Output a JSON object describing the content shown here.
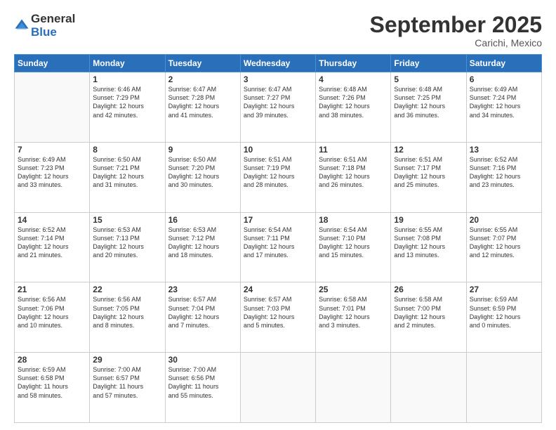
{
  "logo": {
    "general": "General",
    "blue": "Blue"
  },
  "header": {
    "month": "September 2025",
    "location": "Carichi, Mexico"
  },
  "days_of_week": [
    "Sunday",
    "Monday",
    "Tuesday",
    "Wednesday",
    "Thursday",
    "Friday",
    "Saturday"
  ],
  "weeks": [
    [
      {
        "day": "",
        "info": ""
      },
      {
        "day": "1",
        "info": "Sunrise: 6:46 AM\nSunset: 7:29 PM\nDaylight: 12 hours\nand 42 minutes."
      },
      {
        "day": "2",
        "info": "Sunrise: 6:47 AM\nSunset: 7:28 PM\nDaylight: 12 hours\nand 41 minutes."
      },
      {
        "day": "3",
        "info": "Sunrise: 6:47 AM\nSunset: 7:27 PM\nDaylight: 12 hours\nand 39 minutes."
      },
      {
        "day": "4",
        "info": "Sunrise: 6:48 AM\nSunset: 7:26 PM\nDaylight: 12 hours\nand 38 minutes."
      },
      {
        "day": "5",
        "info": "Sunrise: 6:48 AM\nSunset: 7:25 PM\nDaylight: 12 hours\nand 36 minutes."
      },
      {
        "day": "6",
        "info": "Sunrise: 6:49 AM\nSunset: 7:24 PM\nDaylight: 12 hours\nand 34 minutes."
      }
    ],
    [
      {
        "day": "7",
        "info": "Sunrise: 6:49 AM\nSunset: 7:23 PM\nDaylight: 12 hours\nand 33 minutes."
      },
      {
        "day": "8",
        "info": "Sunrise: 6:50 AM\nSunset: 7:21 PM\nDaylight: 12 hours\nand 31 minutes."
      },
      {
        "day": "9",
        "info": "Sunrise: 6:50 AM\nSunset: 7:20 PM\nDaylight: 12 hours\nand 30 minutes."
      },
      {
        "day": "10",
        "info": "Sunrise: 6:51 AM\nSunset: 7:19 PM\nDaylight: 12 hours\nand 28 minutes."
      },
      {
        "day": "11",
        "info": "Sunrise: 6:51 AM\nSunset: 7:18 PM\nDaylight: 12 hours\nand 26 minutes."
      },
      {
        "day": "12",
        "info": "Sunrise: 6:51 AM\nSunset: 7:17 PM\nDaylight: 12 hours\nand 25 minutes."
      },
      {
        "day": "13",
        "info": "Sunrise: 6:52 AM\nSunset: 7:16 PM\nDaylight: 12 hours\nand 23 minutes."
      }
    ],
    [
      {
        "day": "14",
        "info": "Sunrise: 6:52 AM\nSunset: 7:14 PM\nDaylight: 12 hours\nand 21 minutes."
      },
      {
        "day": "15",
        "info": "Sunrise: 6:53 AM\nSunset: 7:13 PM\nDaylight: 12 hours\nand 20 minutes."
      },
      {
        "day": "16",
        "info": "Sunrise: 6:53 AM\nSunset: 7:12 PM\nDaylight: 12 hours\nand 18 minutes."
      },
      {
        "day": "17",
        "info": "Sunrise: 6:54 AM\nSunset: 7:11 PM\nDaylight: 12 hours\nand 17 minutes."
      },
      {
        "day": "18",
        "info": "Sunrise: 6:54 AM\nSunset: 7:10 PM\nDaylight: 12 hours\nand 15 minutes."
      },
      {
        "day": "19",
        "info": "Sunrise: 6:55 AM\nSunset: 7:08 PM\nDaylight: 12 hours\nand 13 minutes."
      },
      {
        "day": "20",
        "info": "Sunrise: 6:55 AM\nSunset: 7:07 PM\nDaylight: 12 hours\nand 12 minutes."
      }
    ],
    [
      {
        "day": "21",
        "info": "Sunrise: 6:56 AM\nSunset: 7:06 PM\nDaylight: 12 hours\nand 10 minutes."
      },
      {
        "day": "22",
        "info": "Sunrise: 6:56 AM\nSunset: 7:05 PM\nDaylight: 12 hours\nand 8 minutes."
      },
      {
        "day": "23",
        "info": "Sunrise: 6:57 AM\nSunset: 7:04 PM\nDaylight: 12 hours\nand 7 minutes."
      },
      {
        "day": "24",
        "info": "Sunrise: 6:57 AM\nSunset: 7:03 PM\nDaylight: 12 hours\nand 5 minutes."
      },
      {
        "day": "25",
        "info": "Sunrise: 6:58 AM\nSunset: 7:01 PM\nDaylight: 12 hours\nand 3 minutes."
      },
      {
        "day": "26",
        "info": "Sunrise: 6:58 AM\nSunset: 7:00 PM\nDaylight: 12 hours\nand 2 minutes."
      },
      {
        "day": "27",
        "info": "Sunrise: 6:59 AM\nSunset: 6:59 PM\nDaylight: 12 hours\nand 0 minutes."
      }
    ],
    [
      {
        "day": "28",
        "info": "Sunrise: 6:59 AM\nSunset: 6:58 PM\nDaylight: 11 hours\nand 58 minutes."
      },
      {
        "day": "29",
        "info": "Sunrise: 7:00 AM\nSunset: 6:57 PM\nDaylight: 11 hours\nand 57 minutes."
      },
      {
        "day": "30",
        "info": "Sunrise: 7:00 AM\nSunset: 6:56 PM\nDaylight: 11 hours\nand 55 minutes."
      },
      {
        "day": "",
        "info": ""
      },
      {
        "day": "",
        "info": ""
      },
      {
        "day": "",
        "info": ""
      },
      {
        "day": "",
        "info": ""
      }
    ]
  ]
}
